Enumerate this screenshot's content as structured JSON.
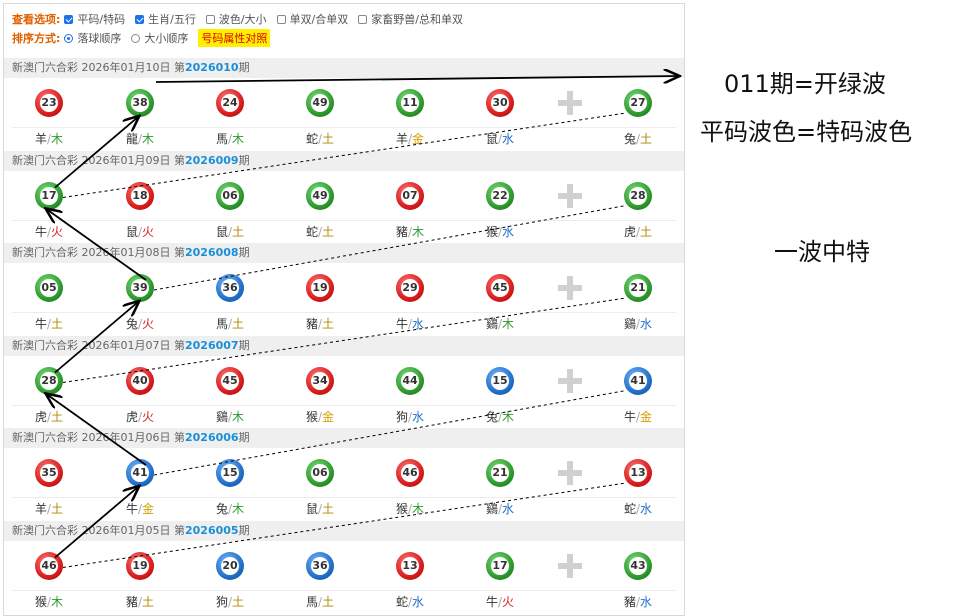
{
  "options": {
    "view_label": "查看选项:",
    "view": [
      {
        "label": "平码/特码",
        "checked": true
      },
      {
        "label": "生肖/五行",
        "checked": true
      },
      {
        "label": "波色/大小",
        "checked": false
      },
      {
        "label": "单双/合单双",
        "checked": false
      },
      {
        "label": "家畜野兽/总和单双",
        "checked": false
      }
    ],
    "sort_label": "排序方式:",
    "sort": [
      {
        "label": "落球顺序",
        "selected": true
      },
      {
        "label": "大小顺序",
        "selected": false
      }
    ],
    "attr_button": "号码属性对照"
  },
  "draw_prefix": "新澳门六合彩",
  "issue_prefix": "第",
  "issue_suffix": "期",
  "draws": [
    {
      "date": "2026年01月10日",
      "issue": "2026010",
      "balls": [
        {
          "num": "23",
          "color": "red",
          "zodiac": "羊",
          "element": "木"
        },
        {
          "num": "38",
          "color": "green",
          "zodiac": "龍",
          "element": "木"
        },
        {
          "num": "24",
          "color": "red",
          "zodiac": "馬",
          "element": "木"
        },
        {
          "num": "49",
          "color": "green",
          "zodiac": "蛇",
          "element": "土"
        },
        {
          "num": "11",
          "color": "green",
          "zodiac": "羊",
          "element": "金"
        },
        {
          "num": "30",
          "color": "red",
          "zodiac": "鼠",
          "element": "水"
        }
      ],
      "special": {
        "num": "27",
        "color": "green",
        "zodiac": "兔",
        "element": "土"
      }
    },
    {
      "date": "2026年01月09日",
      "issue": "2026009",
      "balls": [
        {
          "num": "17",
          "color": "green",
          "zodiac": "牛",
          "element": "火"
        },
        {
          "num": "18",
          "color": "red",
          "zodiac": "鼠",
          "element": "火"
        },
        {
          "num": "06",
          "color": "green",
          "zodiac": "鼠",
          "element": "土"
        },
        {
          "num": "49",
          "color": "green",
          "zodiac": "蛇",
          "element": "土"
        },
        {
          "num": "07",
          "color": "red",
          "zodiac": "豬",
          "element": "木"
        },
        {
          "num": "22",
          "color": "green",
          "zodiac": "猴",
          "element": "水"
        }
      ],
      "special": {
        "num": "28",
        "color": "green",
        "zodiac": "虎",
        "element": "土"
      }
    },
    {
      "date": "2026年01月08日",
      "issue": "2026008",
      "balls": [
        {
          "num": "05",
          "color": "green",
          "zodiac": "牛",
          "element": "土"
        },
        {
          "num": "39",
          "color": "green",
          "zodiac": "兔",
          "element": "火"
        },
        {
          "num": "36",
          "color": "blue",
          "zodiac": "馬",
          "element": "土"
        },
        {
          "num": "19",
          "color": "red",
          "zodiac": "豬",
          "element": "土"
        },
        {
          "num": "29",
          "color": "red",
          "zodiac": "牛",
          "element": "水"
        },
        {
          "num": "45",
          "color": "red",
          "zodiac": "鷄",
          "element": "木"
        }
      ],
      "special": {
        "num": "21",
        "color": "green",
        "zodiac": "鷄",
        "element": "水"
      }
    },
    {
      "date": "2026年01月07日",
      "issue": "2026007",
      "balls": [
        {
          "num": "28",
          "color": "green",
          "zodiac": "虎",
          "element": "土"
        },
        {
          "num": "40",
          "color": "red",
          "zodiac": "虎",
          "element": "火"
        },
        {
          "num": "45",
          "color": "red",
          "zodiac": "鷄",
          "element": "木"
        },
        {
          "num": "34",
          "color": "red",
          "zodiac": "猴",
          "element": "金"
        },
        {
          "num": "44",
          "color": "green",
          "zodiac": "狗",
          "element": "水"
        },
        {
          "num": "15",
          "color": "blue",
          "zodiac": "兔",
          "element": "木"
        }
      ],
      "special": {
        "num": "41",
        "color": "blue",
        "zodiac": "牛",
        "element": "金"
      }
    },
    {
      "date": "2026年01月06日",
      "issue": "2026006",
      "balls": [
        {
          "num": "35",
          "color": "red",
          "zodiac": "羊",
          "element": "土"
        },
        {
          "num": "41",
          "color": "blue",
          "zodiac": "牛",
          "element": "金"
        },
        {
          "num": "15",
          "color": "blue",
          "zodiac": "兔",
          "element": "木"
        },
        {
          "num": "06",
          "color": "green",
          "zodiac": "鼠",
          "element": "土"
        },
        {
          "num": "46",
          "color": "red",
          "zodiac": "猴",
          "element": "木"
        },
        {
          "num": "21",
          "color": "green",
          "zodiac": "鷄",
          "element": "水"
        }
      ],
      "special": {
        "num": "13",
        "color": "red",
        "zodiac": "蛇",
        "element": "水"
      }
    },
    {
      "date": "2026年01月05日",
      "issue": "2026005",
      "balls": [
        {
          "num": "46",
          "color": "red",
          "zodiac": "猴",
          "element": "木"
        },
        {
          "num": "19",
          "color": "red",
          "zodiac": "豬",
          "element": "土"
        },
        {
          "num": "20",
          "color": "blue",
          "zodiac": "狗",
          "element": "土"
        },
        {
          "num": "36",
          "color": "blue",
          "zodiac": "馬",
          "element": "土"
        },
        {
          "num": "13",
          "color": "red",
          "zodiac": "蛇",
          "element": "水"
        },
        {
          "num": "17",
          "color": "green",
          "zodiac": "牛",
          "element": "火"
        }
      ],
      "special": {
        "num": "43",
        "color": "green",
        "zodiac": "豬",
        "element": "水"
      }
    }
  ],
  "annotations": {
    "note1": "011期=开绿波",
    "note2": "平码波色=特码波色",
    "note3": "一波中特"
  }
}
